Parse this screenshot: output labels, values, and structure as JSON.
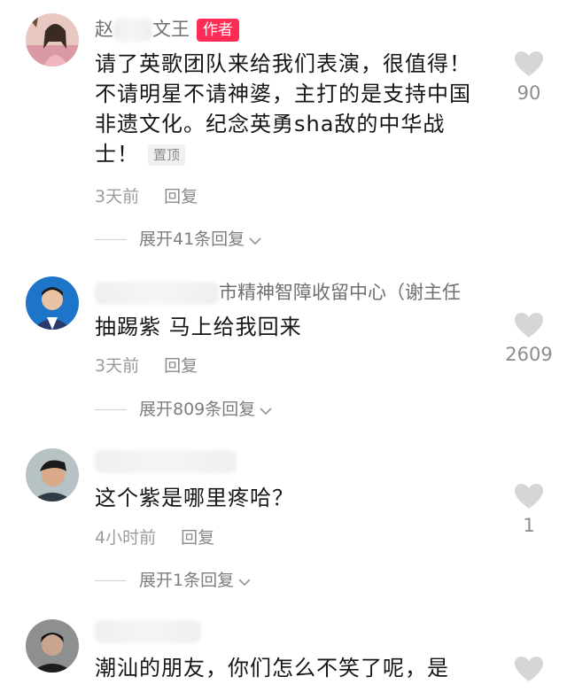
{
  "comments": [
    {
      "name_prefix": "赵",
      "name_suffix": "文王",
      "author_badge": "作者",
      "text": "请了英歌团队来给我们表演，很值得！不请明星不请神婆，主打的是支持中国非遗文化。纪念英勇sha敌的中华战士！",
      "pin_label": "置顶",
      "time": "3天前",
      "reply_label": "回复",
      "expand_label": "展开41条回复",
      "like_count": "90",
      "avatar": "woman-photo-avatar"
    },
    {
      "name_suffix": "市精神智障收留中心（谢主任",
      "text": "抽踢紫  马上给我回来",
      "time": "3天前",
      "reply_label": "回复",
      "expand_label": "展开809条回复",
      "like_count": "2609",
      "avatar": "man-suit-avatar"
    },
    {
      "text": "这个紫是哪里疼哈？",
      "time": "4小时前",
      "reply_label": "回复",
      "expand_label": "展开1条回复",
      "like_count": "1",
      "avatar": "boy-photo-avatar"
    },
    {
      "text": "潮汕的朋友，你们怎么不笑了呢，是",
      "avatar": "man-dark-avatar"
    }
  ],
  "colors": {
    "badge": "#fe2c55",
    "heart": "#d6d6d6"
  },
  "icons": {
    "like": "heart-icon",
    "expand": "chevron-down-icon"
  }
}
